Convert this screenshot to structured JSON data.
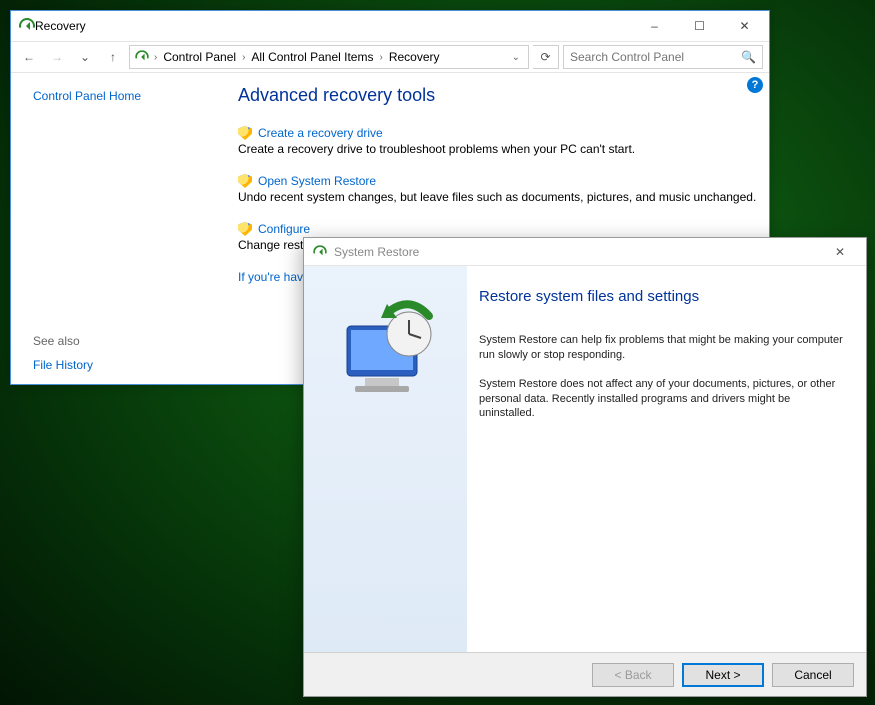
{
  "window": {
    "title": "Recovery",
    "minimize": "–",
    "maximize": "☐",
    "close": "✕"
  },
  "nav": {
    "back": "←",
    "forward": "→",
    "recent": "⌄",
    "up": "↑",
    "refresh": "⟳"
  },
  "breadcrumb": {
    "items": [
      "Control Panel",
      "All Control Panel Items",
      "Recovery"
    ],
    "sep": "›"
  },
  "search": {
    "placeholder": "Search Control Panel",
    "icon": "🔍"
  },
  "sidebar": {
    "home": "Control Panel Home",
    "see_also_label": "See also",
    "file_history": "File History"
  },
  "content": {
    "heading": "Advanced recovery tools",
    "help": "?",
    "tools": [
      {
        "link": "Create a recovery drive",
        "desc": "Create a recovery drive to troubleshoot problems when your PC can't start."
      },
      {
        "link": "Open System Restore",
        "desc": "Undo recent system changes, but leave files such as documents, pictures, and music unchanged."
      },
      {
        "link": "Configure",
        "desc": "Change resto"
      }
    ],
    "extra_link": "If you're havi"
  },
  "dialog": {
    "title": "System Restore",
    "close": "✕",
    "heading": "Restore system files and settings",
    "para1": "System Restore can help fix problems that might be making your computer run slowly or stop responding.",
    "para2": "System Restore does not affect any of your documents, pictures, or other personal data. Recently installed programs and drivers might be uninstalled.",
    "back": "< Back",
    "next": "Next >",
    "cancel": "Cancel"
  }
}
